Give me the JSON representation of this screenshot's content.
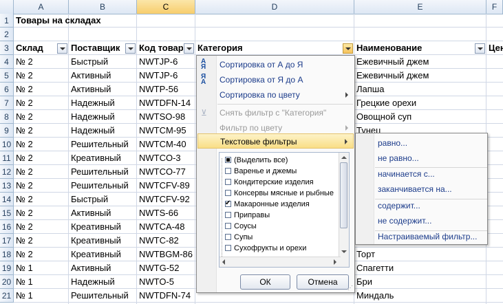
{
  "columns": [
    "A",
    "B",
    "C",
    "D",
    "E",
    "F"
  ],
  "row_numbers": [
    "1",
    "2",
    "3",
    "4",
    "5",
    "6",
    "7",
    "8",
    "9",
    "10",
    "11",
    "12",
    "13",
    "14",
    "15",
    "16",
    "17",
    "18",
    "19",
    "20",
    "21"
  ],
  "title": "Товары на складах",
  "headers": {
    "a": "Склад",
    "b": "Поставщик",
    "c": "Код товар",
    "d": "Категория",
    "e": "Наименование",
    "f": "Цен"
  },
  "rows": [
    {
      "a": "№ 2",
      "b": "Быстрый",
      "c": "NWTJP-6",
      "e": "Ежевичный джем"
    },
    {
      "a": "№ 2",
      "b": "Активный",
      "c": "NWTJP-6",
      "e": "Ежевичный джем"
    },
    {
      "a": "№ 2",
      "b": "Активный",
      "c": "NWTP-56",
      "e": "Лапша"
    },
    {
      "a": "№ 2",
      "b": "Надежный",
      "c": "NWTDFN-14",
      "e": "Грецкие орехи"
    },
    {
      "a": "№ 2",
      "b": "Надежный",
      "c": "NWTSO-98",
      "e": "Овощной суп"
    },
    {
      "a": "№ 2",
      "b": "Надежный",
      "c": "NWTCM-95",
      "e": "Тунец"
    },
    {
      "a": "№ 2",
      "b": "Решительный",
      "c": "NWTCM-40",
      "e": ""
    },
    {
      "a": "№ 2",
      "b": "Креативный",
      "c": "NWTCO-3",
      "e": ""
    },
    {
      "a": "№ 2",
      "b": "Решительный",
      "c": "NWTCO-77",
      "e": ""
    },
    {
      "a": "№ 2",
      "b": "Решительный",
      "c": "NWTCFV-89",
      "e": ""
    },
    {
      "a": "№ 2",
      "b": "Быстрый",
      "c": "NWTCFV-92",
      "e": ""
    },
    {
      "a": "№ 2",
      "b": "Активный",
      "c": "NWTS-66",
      "e": ""
    },
    {
      "a": "№ 2",
      "b": "Креативный",
      "c": "NWTCA-48",
      "e": ""
    },
    {
      "a": "№ 2",
      "b": "Креативный",
      "c": "NWTC-82",
      "e": ""
    },
    {
      "a": "№ 2",
      "b": "Креативный",
      "c": "NWTBGM-86",
      "e": "Торт"
    },
    {
      "a": "№ 1",
      "b": "Активный",
      "c": "NWTG-52",
      "e": "Спагетти"
    },
    {
      "a": "№ 1",
      "b": "Надежный",
      "c": "NWTO-5",
      "e": "Бри"
    },
    {
      "a": "№ 1",
      "b": "Решительный",
      "c": "NWTDFN-74",
      "e": "Миндаль"
    }
  ],
  "menu": {
    "sort_az": "Сортировка от А до Я",
    "sort_za": "Сортировка от Я до А",
    "sort_color": "Сортировка по цвету",
    "clear_filter": "Снять фильтр с \"Категория\"",
    "filter_color": "Фильтр по цвету",
    "text_filters": "Текстовые фильтры",
    "list": [
      {
        "label": "(Выделить все)",
        "state": "partial"
      },
      {
        "label": "Варенье и джемы",
        "state": "off"
      },
      {
        "label": "Кондитерские изделия",
        "state": "off"
      },
      {
        "label": "Консервы мясные и рыбные",
        "state": "off"
      },
      {
        "label": "Макаронные изделия",
        "state": "on"
      },
      {
        "label": "Приправы",
        "state": "off"
      },
      {
        "label": "Соусы",
        "state": "off"
      },
      {
        "label": "Супы",
        "state": "off"
      },
      {
        "label": "Сухофрукты и орехи",
        "state": "off"
      }
    ],
    "ok": "ОК",
    "cancel": "Отмена"
  },
  "submenu": {
    "equals": "равно...",
    "not_equals": "не равно...",
    "begins_with": "начинается с...",
    "ends_with": "заканчивается на...",
    "contains": "содержит...",
    "not_contains": "не содержит...",
    "custom": "Настраиваемый фильтр..."
  },
  "colors": {
    "header_bg": "#e4ecf7",
    "selected_col": "#f7cd6c",
    "menu_highlight": "#f9de86",
    "link_text": "#1b3b8a"
  }
}
